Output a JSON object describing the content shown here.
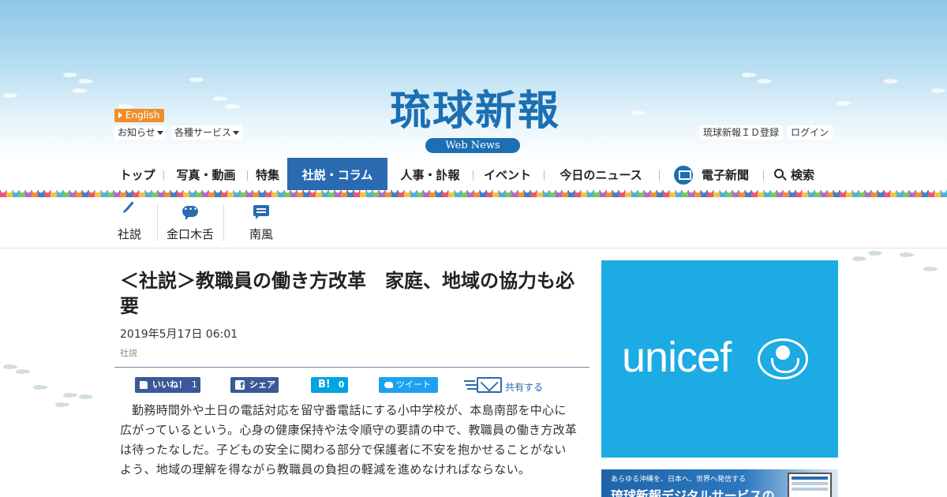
{
  "header": {
    "logo": "琉球新報",
    "logo_sub": "Web News",
    "english": "English",
    "notices": "お知らせ",
    "services": "各種サービス",
    "id_register": "琉球新報ＩＤ登録",
    "login": "ログイン"
  },
  "nav": {
    "items": [
      {
        "label": "トップ"
      },
      {
        "label": "写真・動画"
      },
      {
        "label": "特集"
      },
      {
        "label": "社説・コラム",
        "active": true
      },
      {
        "label": "人事・訃報"
      },
      {
        "label": "イベント"
      },
      {
        "label": "今日のニュース"
      },
      {
        "label": "電子新聞"
      },
      {
        "label": "検索"
      }
    ],
    "active_color": "#2a6ab0"
  },
  "subnav": {
    "items": [
      {
        "label": "社説",
        "icon": "pen-icon"
      },
      {
        "label": "金口木舌",
        "icon": "speech-bubble-icon"
      },
      {
        "label": "南風",
        "icon": "note-icon"
      }
    ]
  },
  "article": {
    "title": "＜社説＞教職員の働き方改革　家庭、地域の協力も必要",
    "date": "2019年5月17日 06:01",
    "category": "社説",
    "share": {
      "like_label": "いいね！",
      "like_count": "1",
      "fb_share": "シェア",
      "hatena_label": "B!",
      "hatena_count": "0",
      "tweet": "ツイート",
      "mail_share": "共有する"
    },
    "body": "勤務時間外や土日の電話対応を留守番電話にする小中学校が、本島南部を中心に広がっているという。心身の健康保持や法令順守の要請の中で、教職員の働き方改革は待ったなしだ。子どもの安全に関わる部分で保護者に不安を抱かせることがないよう、地域の理解を得ながら教職員の負担の軽減を進めなければならない。"
  },
  "ads": {
    "unicef": "unicef",
    "digital_sub": "あらゆる沖縄を、日本へ、世界へ発信する",
    "digital_main": "琉球新報デジタルサービスの"
  },
  "colors": {
    "brand": "#1b6fb2",
    "unicef": "#1cabe2",
    "facebook": "#3b5998",
    "hatena": "#00a4de",
    "twitter": "#1da1f2",
    "english_button": "#ee8f2a"
  }
}
